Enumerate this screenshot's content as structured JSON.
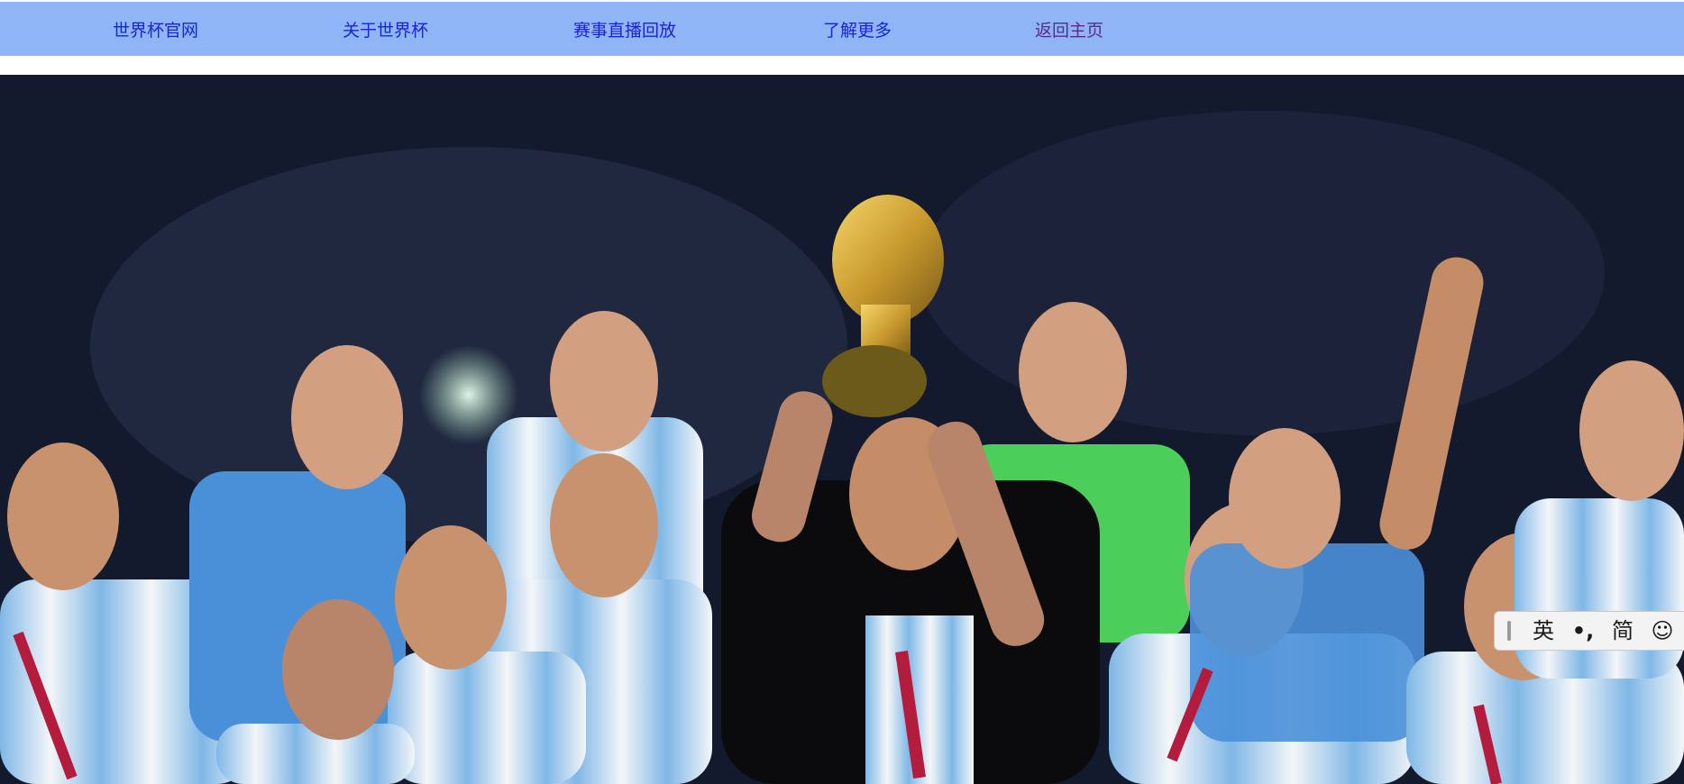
{
  "nav": {
    "items": [
      {
        "label": "世界杯官网"
      },
      {
        "label": "关于世界杯"
      },
      {
        "label": "赛事直播回放"
      },
      {
        "label": "了解更多"
      },
      {
        "label": "返回主页"
      }
    ],
    "background_color": "#8fb5f7",
    "link_color": "#1a24d6",
    "visited_link_color": "#5a2a8a"
  },
  "hero": {
    "image": "argentina-team-celebrating-world-cup-trophy"
  },
  "ime_toolbar": {
    "language": "英",
    "punctuation": "•,",
    "script": "简",
    "emoji_icon": "smiley-icon"
  }
}
